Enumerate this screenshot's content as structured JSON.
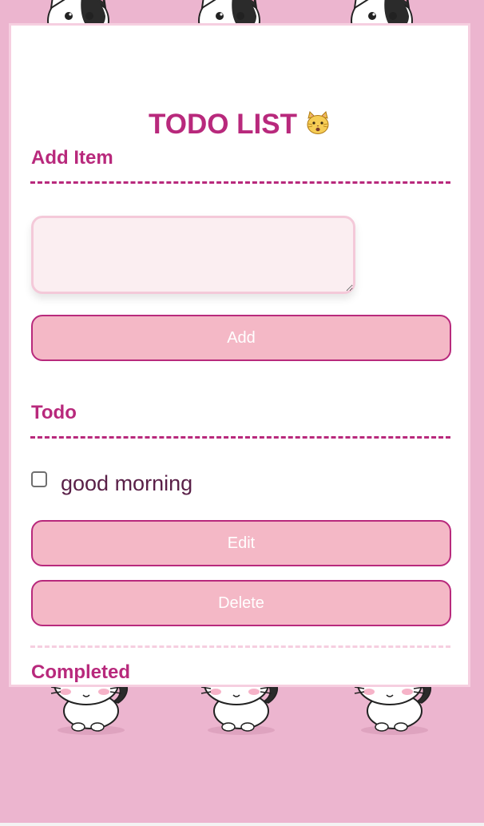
{
  "app": {
    "title": "TODO LIST",
    "title_icon": "cat-face-icon"
  },
  "add_section": {
    "heading": "Add Item",
    "input_value": "",
    "input_placeholder": "",
    "add_button_label": "Add"
  },
  "todo_section": {
    "heading": "Todo",
    "items": [
      {
        "text": "good morning",
        "checked": false,
        "edit_label": "Edit",
        "delete_label": "Delete"
      }
    ]
  },
  "completed_section": {
    "heading": "Completed"
  },
  "colors": {
    "background": "#ecb5cf",
    "accent": "#b8297c",
    "button_fill": "#f4b8c6",
    "input_fill": "#fbeef1",
    "card_border": "#f6cfe0",
    "item_text": "#5a2048"
  },
  "background_pattern": "kitten-pattern"
}
